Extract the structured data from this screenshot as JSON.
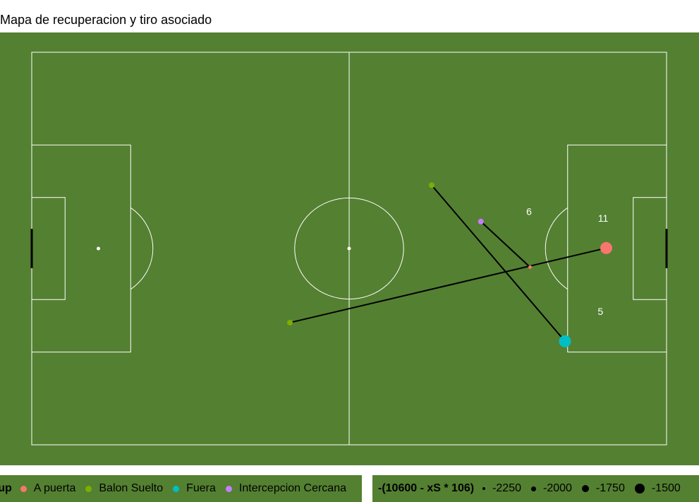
{
  "colors": {
    "pitch": "#548032",
    "lines": "#ffffff",
    "connector": "#000000",
    "size_key": "#000000",
    "A puerta": "#F8766D",
    "Balon Suelto": "#7CAE00",
    "Fuera": "#00BFC4",
    "Intercepcion Cercana": "#C77CFF"
  },
  "chart_data": {
    "type": "scatter",
    "title": "Mapa de recuperacion y tiro asociado",
    "xlim": [
      0,
      120
    ],
    "ylim": [
      0,
      80
    ],
    "grid": false,
    "legend_position": "bottom",
    "color_legend": {
      "title": "up",
      "entries": [
        "A puerta",
        "Balon Suelto",
        "Fuera",
        "Intercepcion Cercana"
      ]
    },
    "size_legend": {
      "title": "-(10600 - xS * 106)",
      "entries": [
        {
          "label": "-2250",
          "value": -2250
        },
        {
          "label": "-2000",
          "value": -2000
        },
        {
          "label": "-1750",
          "value": -1750
        },
        {
          "label": "-1500",
          "value": -1500
        }
      ]
    },
    "recoveries": [
      {
        "x": 75.6,
        "y": 52.9,
        "group": "Balon Suelto",
        "shot_x": 100.8,
        "shot_y": 21.1
      },
      {
        "x": 48.8,
        "y": 24.9,
        "group": "Balon Suelto",
        "shot_x": 108.6,
        "shot_y": 40.1
      },
      {
        "x": 84.9,
        "y": 45.5,
        "group": "Intercepcion Cercana",
        "shot_x": 94.2,
        "shot_y": 36.2
      }
    ],
    "shots": [
      {
        "x": 108.6,
        "y": 40.1,
        "group": "A puerta",
        "size": -1500,
        "label": "11"
      },
      {
        "x": 100.8,
        "y": 21.1,
        "group": "Fuera",
        "size": -1500,
        "label": "5"
      },
      {
        "x": 94.2,
        "y": 36.2,
        "group": "A puerta",
        "size": -2250,
        "label": "6"
      }
    ],
    "shot_labels": [
      {
        "x": 108.0,
        "y": 46.0,
        "text": "11"
      },
      {
        "x": 107.5,
        "y": 27.0,
        "text": "5"
      },
      {
        "x": 94.0,
        "y": 47.4,
        "text": "6"
      }
    ]
  }
}
